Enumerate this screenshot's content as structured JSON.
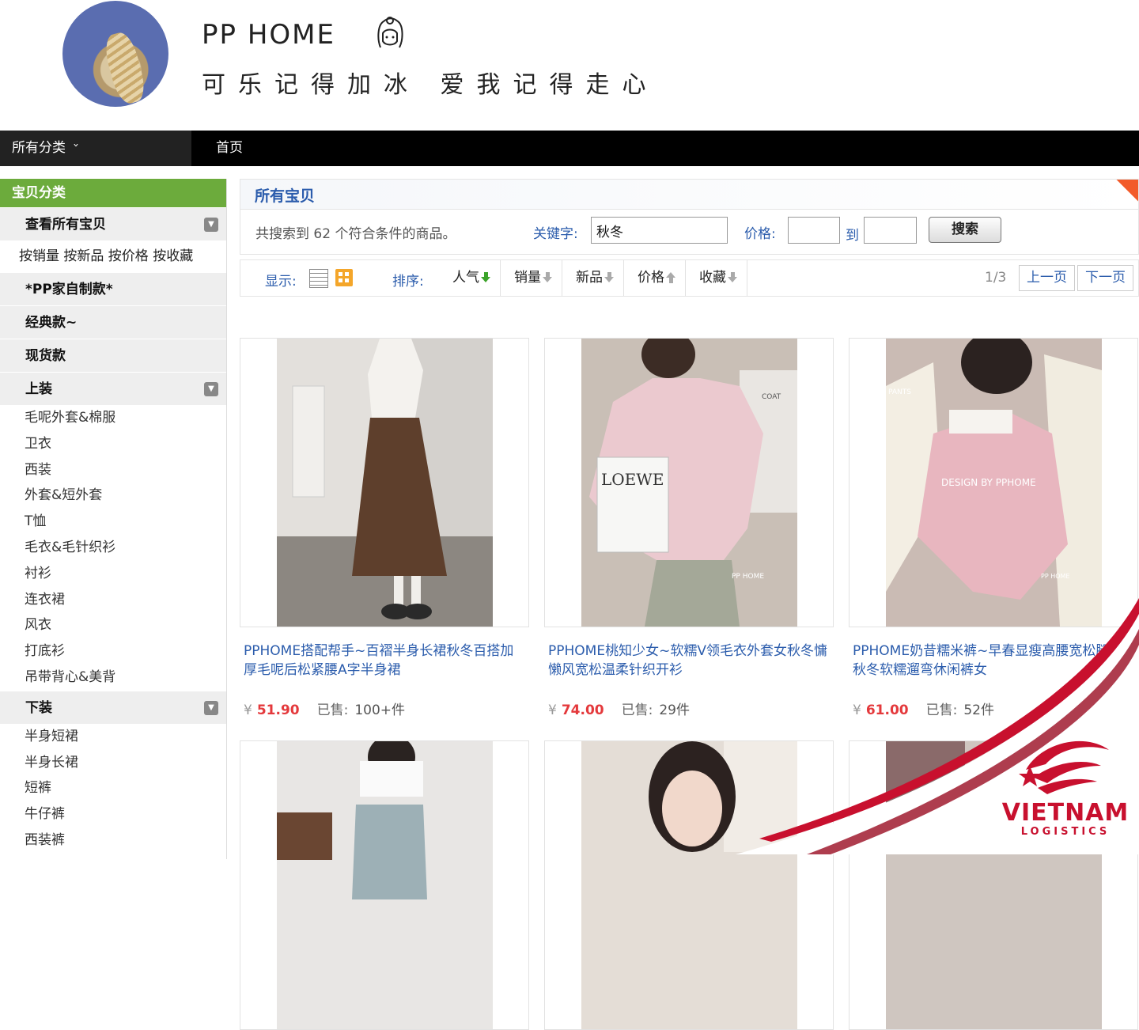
{
  "banner": {
    "shop_name": "PP HOME",
    "slogan": "可乐记得加冰 爱我记得走心"
  },
  "navbar": {
    "category_label": "所有分类",
    "home_label": "首页"
  },
  "sidebar": {
    "header": "宝贝分类",
    "view_all": "查看所有宝贝",
    "sort_links": "按销量 按新品 按价格 按收藏",
    "groups": [
      "*PP家自制款*",
      "经典款~",
      "现货款",
      "上装",
      "下装"
    ],
    "tops": [
      "毛呢外套&棉服",
      "卫衣",
      "西装",
      "外套&短外套",
      "T恤",
      "毛衣&毛针织衫",
      "衬衫",
      "连衣裙",
      "风衣",
      "打底衫",
      "吊带背心&美背"
    ],
    "bottoms": [
      "半身短裙",
      "半身长裙",
      "短裤",
      "牛仔裤",
      "西装裤"
    ]
  },
  "main": {
    "title": "所有宝贝",
    "summary": "共搜索到 62 个符合条件的商品。",
    "keyword_label": "关键字:",
    "keyword_value": "秋冬",
    "price_label": "价格:",
    "to_label": "到",
    "search_button": "搜索",
    "show_label": "显示:",
    "sort_label": "排序:",
    "sort_options": [
      "人气",
      "销量",
      "新品",
      "价格",
      "收藏"
    ],
    "page_indicator": "1/3",
    "prev_page": "上一页",
    "next_page": "下一页"
  },
  "products": [
    {
      "title": "PPHOME搭配帮手~百褶半身长裙秋冬百搭加厚毛呢后松紧腰A字半身裙",
      "currency": "¥",
      "price": "51.90",
      "sold_label": "已售:",
      "sold": "100+件"
    },
    {
      "title": "PPHOME桃知少女~软糯V领毛衣外套女秋冬慵懒风宽松温柔针织开衫",
      "currency": "¥",
      "price": "74.00",
      "sold_label": "已售:",
      "sold": "29件"
    },
    {
      "title": "PPHOME奶昔糯米裤~早春显瘦高腰宽松腿裤秋冬软糯遛弯休闲裤女",
      "currency": "¥",
      "price": "61.00",
      "sold_label": "已售:",
      "sold": "52件"
    }
  ],
  "photo_text": {
    "p2_bag": "LOEWE",
    "p2_tag": "COAT",
    "p2_watermark": "PP HOME",
    "p3_tag": "PANTS",
    "p3_watermark": "DESIGN BY PPHOME",
    "p3_brand": "PP HOME"
  },
  "logo": {
    "word": "VIETNAM",
    "sub": "LOGISTICS"
  },
  "colors": {
    "accent_blue": "#2b5cac",
    "sidebar_green": "#6cab3c",
    "price_red": "#e4393c",
    "logo_red": "#c8102e"
  }
}
